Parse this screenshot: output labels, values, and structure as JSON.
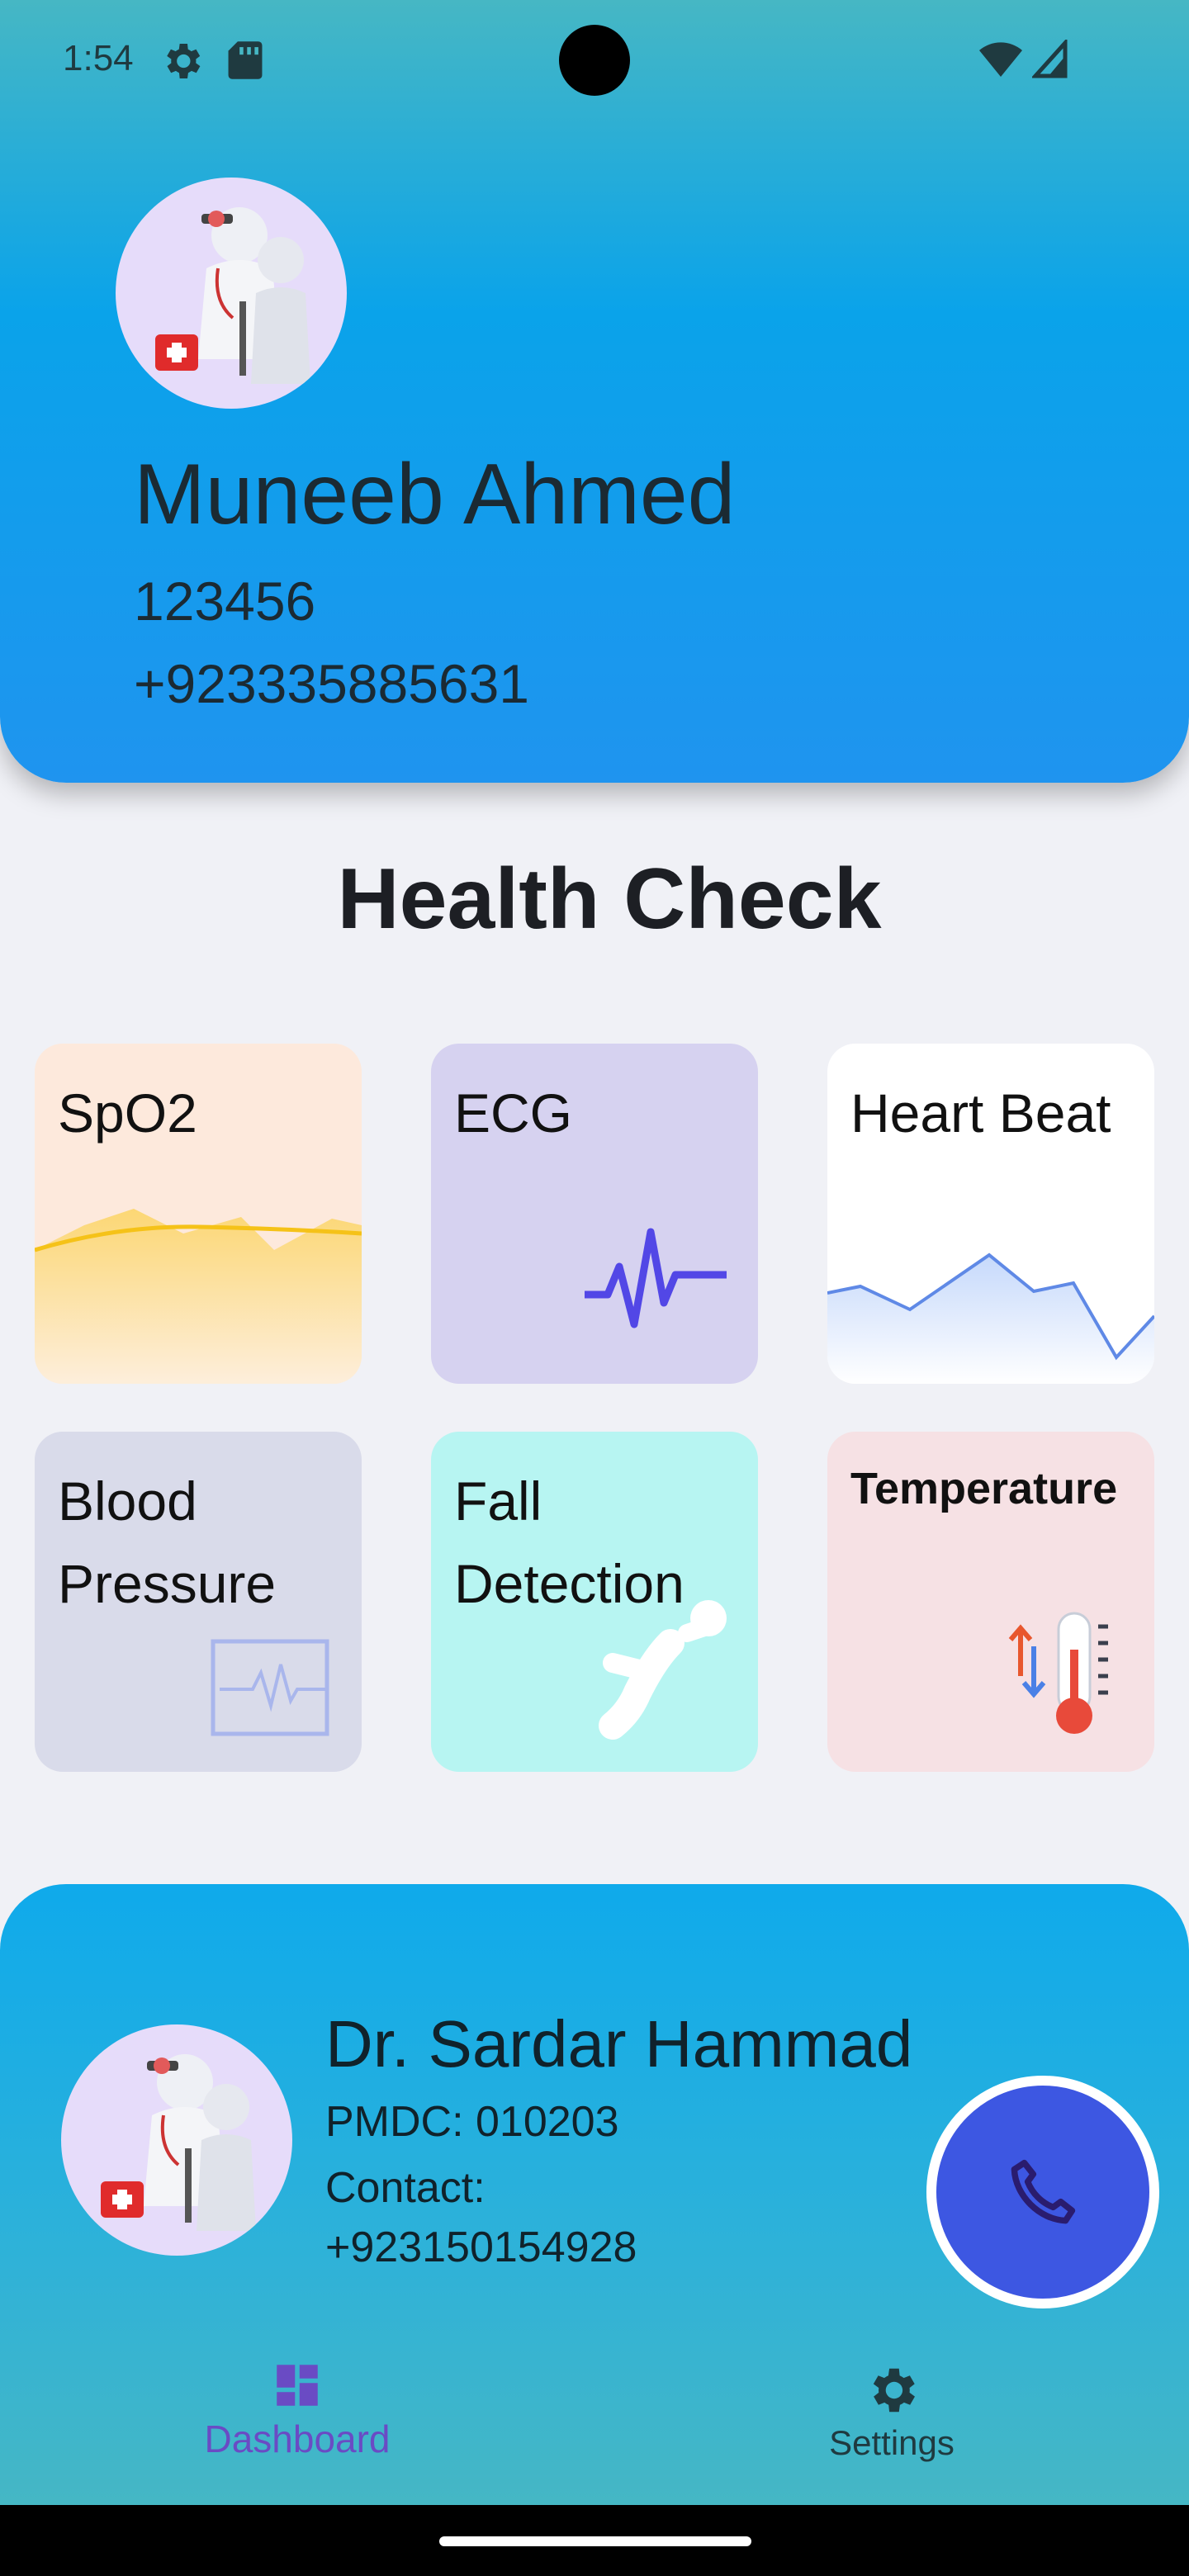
{
  "status_bar": {
    "time": "1:54"
  },
  "profile": {
    "name": "Muneeb Ahmed",
    "id": "123456",
    "phone": "+923335885631"
  },
  "section_title": "Health Check",
  "cards": [
    {
      "title": "SpO2",
      "color": "#fde9dc",
      "icon": "wave-chart-icon"
    },
    {
      "title": "ECG",
      "color": "#d6d2f0",
      "icon": "ecg-pulse-icon"
    },
    {
      "title": "Heart Beat",
      "color": "#ffffff",
      "icon": "line-chart-icon"
    },
    {
      "title": "Blood Pressure",
      "color": "#d9dbea",
      "icon": "monitor-pulse-icon"
    },
    {
      "title": "Fall Detection",
      "color": "#b7f5f2",
      "icon": "falling-person-icon"
    },
    {
      "title": "Temperature",
      "color": "#f6e1e4",
      "icon": "thermometer-icon"
    }
  ],
  "doctor": {
    "name": "Dr. Sardar Hammad",
    "pmdc": "PMDC: 010203",
    "contact_label": "Contact:",
    "contact": "+923150154928"
  },
  "nav": {
    "dashboard": "Dashboard",
    "settings": "Settings"
  },
  "colors": {
    "header_top": "#46b7c4",
    "header_bottom": "#1f94ef",
    "call_button": "#3d57e2",
    "nav_active": "#6a4bc4"
  }
}
